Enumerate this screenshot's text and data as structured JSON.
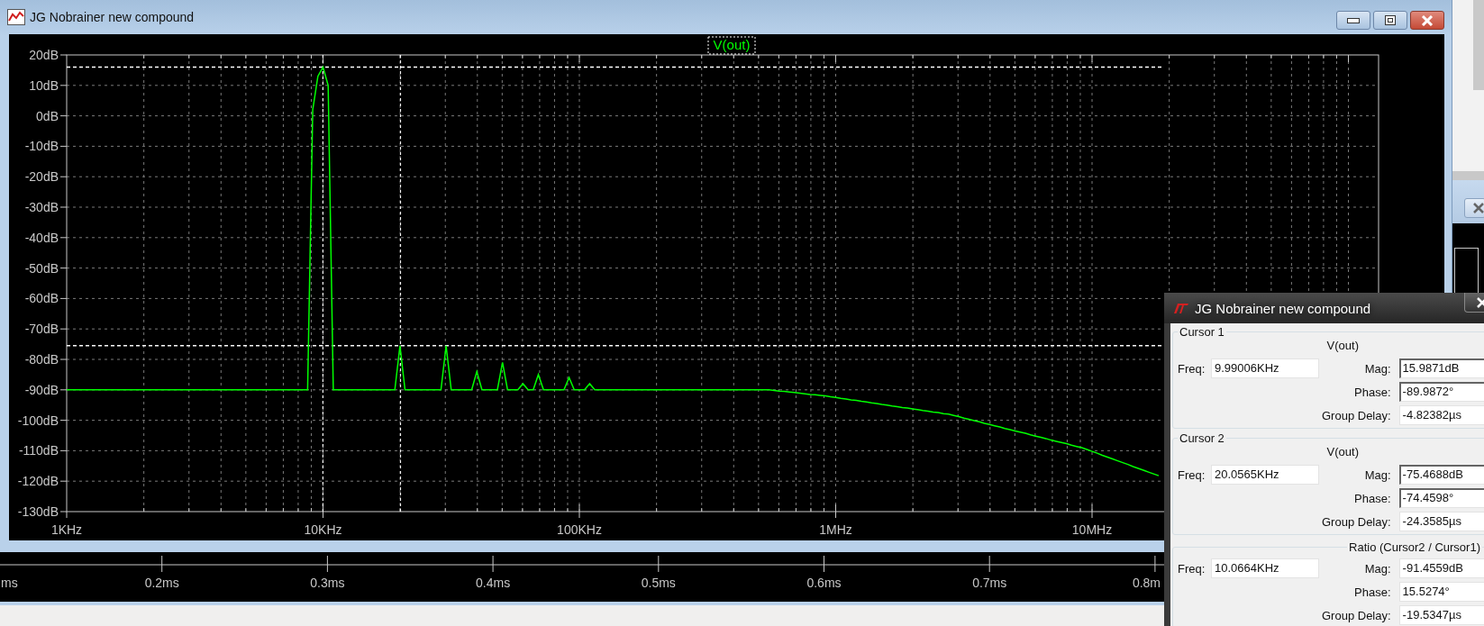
{
  "window": {
    "title": "JG Nobrainer new compound"
  },
  "plot": {
    "chart_data": {
      "type": "line",
      "categories": [
        "1KHz",
        null,
        null,
        null,
        null,
        null,
        null,
        null,
        null,
        null,
        null,
        null,
        null,
        null,
        null,
        null,
        null,
        null,
        null,
        null,
        null,
        null,
        null,
        null,
        null,
        null,
        null,
        null,
        null,
        null,
        null,
        null,
        null,
        null,
        null,
        null,
        null,
        null,
        null,
        null,
        null,
        null,
        null,
        null,
        null,
        null,
        null,
        null,
        null,
        null,
        "10KHz",
        null,
        null,
        null,
        null,
        null,
        null,
        null,
        null,
        null,
        null,
        null,
        null,
        null,
        null,
        null,
        null,
        null,
        null,
        null,
        null,
        null,
        null,
        null,
        null,
        null,
        null,
        null,
        null,
        null,
        null,
        null,
        null,
        null,
        null,
        null,
        null,
        null,
        null,
        null,
        null,
        null,
        null,
        null,
        null,
        null,
        null,
        null,
        null,
        null,
        "100KHz",
        null,
        null,
        null,
        null,
        null,
        null,
        null,
        null,
        null,
        null,
        null,
        null,
        null,
        null,
        null,
        null,
        null,
        null,
        null,
        null,
        null,
        null,
        null,
        null,
        null,
        null,
        null,
        null,
        null,
        null,
        null,
        null,
        null,
        null,
        null,
        null,
        null,
        null,
        null,
        null,
        null,
        null,
        null,
        null,
        null,
        null,
        null,
        null,
        null,
        "1MHz",
        null,
        null,
        null,
        null,
        null,
        null,
        null,
        null,
        null,
        null,
        null,
        null,
        null,
        null,
        null,
        null,
        null,
        null,
        null,
        null,
        null,
        null,
        null,
        null,
        null,
        null,
        null,
        null,
        null,
        null,
        null,
        null,
        null,
        null,
        null,
        null,
        null,
        null,
        null,
        null,
        null,
        null,
        null,
        null,
        null,
        null,
        null,
        null,
        null,
        "10MHz",
        null,
        null,
        null,
        null,
        null,
        null,
        null,
        null,
        null,
        null,
        null,
        null,
        null
      ],
      "series": [
        {
          "name": "V(out)",
          "color": "#00ff00",
          "values": [
            -90,
            -90,
            -90,
            -90,
            -90,
            -90,
            -90,
            -90,
            -90,
            -90,
            -90,
            -90,
            -90,
            -90,
            -90,
            -90,
            -90,
            -90,
            -90,
            -90,
            -90,
            -90,
            -90,
            -90,
            -90,
            -90,
            -90,
            -90,
            -90,
            -90,
            -90,
            -90,
            -90,
            -90,
            -90,
            -90,
            -90,
            -90,
            -90,
            -90,
            -90,
            -90,
            -90,
            -90,
            -90,
            -90,
            -90,
            -90,
            2,
            13,
            16,
            10,
            -90,
            -90,
            -90,
            -90,
            -90,
            -90,
            -90,
            -90,
            -90,
            -90,
            -90,
            -90,
            -90,
            -75.5,
            -90,
            -90,
            -90,
            -90,
            -90,
            -90,
            -90,
            -90,
            -75.5,
            -90,
            -90,
            -90,
            -90,
            -90,
            -84,
            -90,
            -90,
            -90,
            -90,
            -81,
            -90,
            -90,
            -90,
            -88,
            -90,
            -90,
            -85,
            -90,
            -90,
            -90,
            -90,
            -90,
            -86,
            -90,
            -90,
            -90,
            -88,
            -90,
            -90,
            -90,
            -90,
            -90,
            -90,
            -90,
            -90,
            -90,
            -90,
            -90,
            -90,
            -90,
            -90,
            -90,
            -90,
            -90,
            -90,
            -90,
            -90,
            -90,
            -90,
            -90,
            -90,
            -90,
            -90,
            -90,
            -90,
            -90,
            -90,
            -90,
            -90,
            -90,
            -90,
            -90,
            -90.2,
            -90.4,
            -90.5,
            -90.7,
            -90.9,
            -91.1,
            -91.3,
            -91.5,
            -91.6,
            -91.8,
            -92,
            -92.3,
            -92.5,
            -92.8,
            -93,
            -93.3,
            -93.5,
            -93.8,
            -94,
            -94.3,
            -94.5,
            -94.8,
            -95,
            -95.3,
            -95.5,
            -95.8,
            -96,
            -96.3,
            -96.5,
            -96.8,
            -97,
            -97.3,
            -97.5,
            -97.8,
            -98,
            -98.4,
            -98.8,
            -99.3,
            -99.7,
            -100.1,
            -100.5,
            -101,
            -101.4,
            -101.8,
            -102.2,
            -102.7,
            -103.1,
            -103.5,
            -103.9,
            -104.3,
            -104.8,
            -105.2,
            -105.6,
            -106,
            -106.5,
            -106.9,
            -107.3,
            -107.7,
            -108.2,
            -108.6,
            -109,
            -109.6,
            -110.2,
            -110.8,
            -111.5,
            -112.1,
            -112.7,
            -113.3,
            -113.9,
            -114.5,
            -115.2,
            -115.8,
            -116.4,
            -117,
            -117.6,
            -118.2
          ]
        }
      ],
      "ylim": [
        -130,
        20
      ],
      "yticks": [
        {
          "value": 20,
          "label": "20dB"
        },
        {
          "value": 10,
          "label": "10dB"
        },
        {
          "value": 0,
          "label": "0dB"
        },
        {
          "value": -10,
          "label": "-10dB"
        },
        {
          "value": -20,
          "label": "-20dB"
        },
        {
          "value": -30,
          "label": "-30dB"
        },
        {
          "value": -40,
          "label": "-40dB"
        },
        {
          "value": -50,
          "label": "-50dB"
        },
        {
          "value": -60,
          "label": "-60dB"
        },
        {
          "value": -70,
          "label": "-70dB"
        },
        {
          "value": -80,
          "label": "-80dB"
        },
        {
          "value": -90,
          "label": "-90dB"
        },
        {
          "value": -100,
          "label": "-100dB"
        },
        {
          "value": -110,
          "label": "-110dB"
        },
        {
          "value": -120,
          "label": "-120dB"
        },
        {
          "value": -130,
          "label": "-130dB"
        }
      ],
      "grid": true,
      "ref_lines": [
        {
          "axis": "y",
          "value": 15.9871
        },
        {
          "axis": "y",
          "value": -75.4688
        }
      ]
    }
  },
  "time_axis": {
    "labels": [
      "ms",
      "0.2ms",
      "0.3ms",
      "0.4ms",
      "0.5ms",
      "0.6ms",
      "0.7ms",
      "0.8m"
    ]
  },
  "cursor_window": {
    "title": "JG Nobrainer new compound",
    "groups": [
      {
        "heading": "Cursor 1",
        "trace": "V(out)",
        "fields": [
          {
            "label": "Freq:",
            "value": "9.99006KHz",
            "sunken": false
          },
          {
            "label": "Mag:",
            "value": "15.9871dB",
            "sunken": true
          },
          {
            "label": "Phase:",
            "value": "-89.9872°",
            "sunken": true
          },
          {
            "label": "Group Delay:",
            "value": "-4.82382µs",
            "sunken": false
          }
        ]
      },
      {
        "heading": "Cursor 2",
        "trace": "V(out)",
        "fields": [
          {
            "label": "Freq:",
            "value": "20.0565KHz",
            "sunken": false
          },
          {
            "label": "Mag:",
            "value": "-75.4688dB",
            "sunken": true
          },
          {
            "label": "Phase:",
            "value": "-74.4598°",
            "sunken": true
          },
          {
            "label": "Group Delay:",
            "value": "-24.3585µs",
            "sunken": false
          }
        ]
      },
      {
        "heading": "Ratio (Cursor2 / Cursor1)",
        "fields": [
          {
            "label": "Freq:",
            "value": "10.0664KHz",
            "sunken": false
          },
          {
            "label": "Mag:",
            "value": "-91.4559dB",
            "sunken": false
          },
          {
            "label": "Phase:",
            "value": "15.5274°",
            "sunken": false
          },
          {
            "label": "Group Delay:",
            "value": "-19.5347µs",
            "sunken": false
          }
        ]
      }
    ]
  }
}
